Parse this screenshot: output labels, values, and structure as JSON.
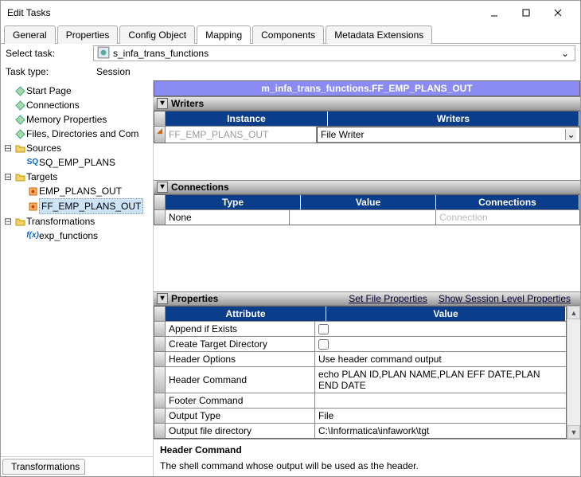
{
  "window": {
    "title": "Edit Tasks"
  },
  "tabs": [
    "General",
    "Properties",
    "Config Object",
    "Mapping",
    "Components",
    "Metadata Extensions"
  ],
  "activeTab": "Mapping",
  "selectTaskLabel": "Select task:",
  "selectTaskValue": "s_infa_trans_functions",
  "taskTypeLabel": "Task type:",
  "taskTypeValue": "Session",
  "tree": {
    "items": [
      {
        "label": "Start Page",
        "icon": "diamond",
        "depth": 1
      },
      {
        "label": "Connections",
        "icon": "diamond",
        "depth": 1
      },
      {
        "label": "Memory Properties",
        "icon": "diamond",
        "depth": 1
      },
      {
        "label": "Files, Directories and Com",
        "icon": "diamond",
        "depth": 1
      },
      {
        "label": "Sources",
        "icon": "folder",
        "depth": 1,
        "twist": "-"
      },
      {
        "label": "SQ_EMP_PLANS",
        "icon": "sq",
        "depth": 2
      },
      {
        "label": "Targets",
        "icon": "folder",
        "depth": 1,
        "twist": "-"
      },
      {
        "label": "EMP_PLANS_OUT",
        "icon": "target",
        "depth": 2
      },
      {
        "label": "FF_EMP_PLANS_OUT",
        "icon": "target",
        "depth": 2,
        "sel": true
      },
      {
        "label": "Transformations",
        "icon": "folder",
        "depth": 1,
        "twist": "-"
      },
      {
        "label": "exp_functions",
        "icon": "fx",
        "depth": 2
      }
    ]
  },
  "sideTab": "Transformations",
  "purpleTitle": "m_infa_trans_functions.FF_EMP_PLANS_OUT",
  "writers": {
    "title": "Writers",
    "cols": [
      "Instance",
      "Writers"
    ],
    "row": {
      "instance": "FF_EMP_PLANS_OUT",
      "writer": "File Writer"
    }
  },
  "connections": {
    "title": "Connections",
    "cols": [
      "Type",
      "Value",
      "Connections"
    ],
    "row": {
      "type": "None",
      "value": "",
      "conn": "Connection"
    }
  },
  "properties": {
    "title": "Properties",
    "links": [
      "Set File Properties",
      "Show Session Level Properties"
    ],
    "cols": [
      "Attribute",
      "Value"
    ],
    "rows": [
      {
        "attr": "Append if Exists",
        "type": "check",
        "val": false
      },
      {
        "attr": "Create Target Directory",
        "type": "check",
        "val": false
      },
      {
        "attr": "Header Options",
        "type": "text",
        "val": "Use header command output"
      },
      {
        "attr": "Header Command",
        "type": "text",
        "val": "echo PLAN ID,PLAN NAME,PLAN EFF DATE,PLAN END DATE"
      },
      {
        "attr": "Footer Command",
        "type": "text",
        "val": ""
      },
      {
        "attr": "Output Type",
        "type": "text",
        "val": "File"
      },
      {
        "attr": "Output file directory",
        "type": "text",
        "val": "C:\\Informatica\\infawork\\tgt"
      }
    ]
  },
  "help": {
    "title": "Header Command",
    "body": "The shell command whose output will be used as the header."
  }
}
